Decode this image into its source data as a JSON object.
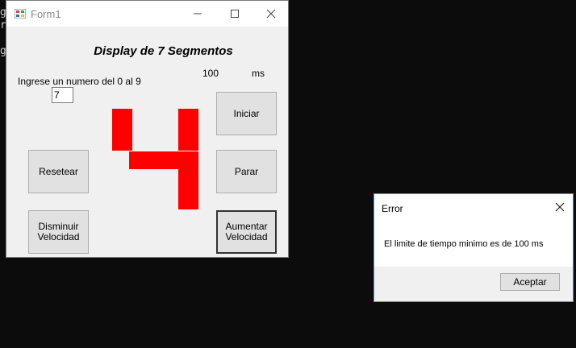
{
  "console": {
    "lines": [
      "g",
      "r",
      "g"
    ]
  },
  "window": {
    "title": "Form1",
    "heading": "Display de 7 Segmentos",
    "prompt_label": "Ingrese un numero del 0 al 9",
    "input_value": "7",
    "speed_value": "100",
    "speed_unit": "ms",
    "buttons": {
      "start": "Iniciar",
      "reset": "Resetear",
      "stop": "Parar",
      "decrease": "Disminuir\nVelocidad",
      "increase": "Aumentar\nVelocidad"
    },
    "display": {
      "digit_shown": "4",
      "segment_color": "#ff0000"
    }
  },
  "dialog": {
    "title": "Error",
    "message": "El limite de tiempo minimo es de 100 ms",
    "ok_label": "Aceptar"
  }
}
